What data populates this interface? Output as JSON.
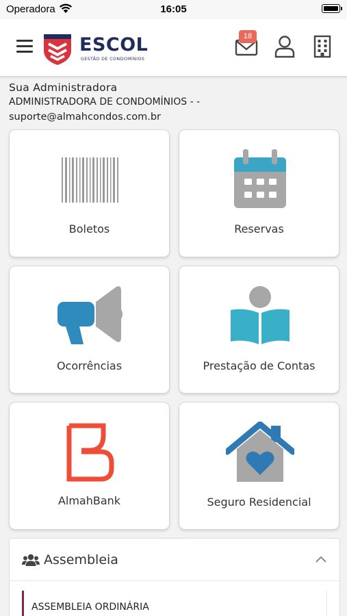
{
  "status_bar": {
    "carrier": "Operadora",
    "time": "16:05",
    "battery_level": 0.92
  },
  "header": {
    "logo_text": "ESCOL",
    "logo_subtitle": "GESTÃO DE CONDOMÍNIOS",
    "mail_badge": "18",
    "icons": [
      "menu-icon",
      "mail-icon",
      "user-icon",
      "building-icon"
    ]
  },
  "admin": {
    "title": "Sua Administradora",
    "name": "ADMINISTRADORA DE CONDOMÍNIOS - -",
    "email": "suporte@almahcondos.com.br"
  },
  "tiles": [
    {
      "label": "Boletos",
      "icon": "barcode-icon"
    },
    {
      "label": "Reservas",
      "icon": "calendar-icon"
    },
    {
      "label": "Ocorrências",
      "icon": "megaphone-icon"
    },
    {
      "label": "Prestação de Contas",
      "icon": "reader-book-icon"
    },
    {
      "label": "AlmahBank",
      "icon": "almahbank-logo"
    },
    {
      "label": "Seguro Residencial",
      "icon": "house-heart-icon"
    }
  ],
  "accordion": {
    "title": "Assembleia",
    "items": [
      {
        "label": "ASSEMBLEIA ORDINÁRIA"
      }
    ]
  },
  "colors": {
    "brand_navy": "#1f2d5a",
    "brand_red": "#d9333f",
    "calendar_teal": "#3aa5c5",
    "megaphone_blue": "#2f8bbd",
    "book_teal": "#3ab0c8",
    "almahbank_orange": "#ee4e38",
    "house_blue": "#2f7ab5",
    "icon_gray": "#a7a7a7",
    "badge": "#e8695a"
  }
}
